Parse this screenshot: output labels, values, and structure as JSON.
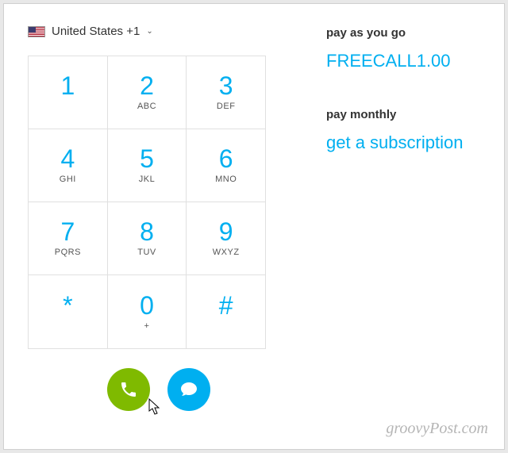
{
  "country": {
    "label": "United States +1"
  },
  "keypad": {
    "rows": [
      [
        {
          "digit": "1",
          "letters": ""
        },
        {
          "digit": "2",
          "letters": "ABC"
        },
        {
          "digit": "3",
          "letters": "DEF"
        }
      ],
      [
        {
          "digit": "4",
          "letters": "GHI"
        },
        {
          "digit": "5",
          "letters": "JKL"
        },
        {
          "digit": "6",
          "letters": "MNO"
        }
      ],
      [
        {
          "digit": "7",
          "letters": "PQRS"
        },
        {
          "digit": "8",
          "letters": "TUV"
        },
        {
          "digit": "9",
          "letters": "WXYZ"
        }
      ],
      [
        {
          "digit": "*",
          "letters": ""
        },
        {
          "digit": "0",
          "letters": "+"
        },
        {
          "digit": "#",
          "letters": ""
        }
      ]
    ]
  },
  "sidebar": {
    "payg_label": "pay as you go",
    "payg_link": "FREECALL1.00",
    "monthly_label": "pay monthly",
    "monthly_link": "get a subscription"
  },
  "watermark": "groovyPost.com",
  "colors": {
    "accent": "#00aff0",
    "call_green": "#7fba00"
  }
}
